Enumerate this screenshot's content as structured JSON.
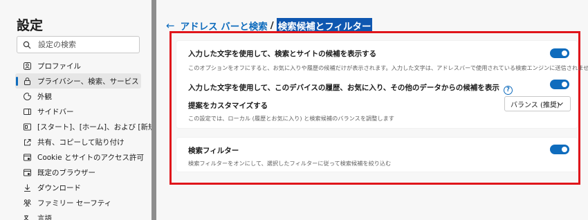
{
  "sidebar": {
    "title": "設定",
    "search_placeholder": "設定の検索",
    "items": [
      {
        "label": "プロファイル",
        "icon": "profile-icon"
      },
      {
        "label": "プライバシー、検索、サービス",
        "icon": "lock-icon",
        "active": true
      },
      {
        "label": "外観",
        "icon": "appearance-icon"
      },
      {
        "label": "サイドバー",
        "icon": "sidebar-icon"
      },
      {
        "label": "[スタート]、[ホーム]、および [新規] タブ",
        "icon": "home-tab-icon"
      },
      {
        "label": "共有、コピーして貼り付け",
        "icon": "share-icon"
      },
      {
        "label": "Cookie とサイトのアクセス許可",
        "icon": "cookie-icon"
      },
      {
        "label": "既定のブラウザー",
        "icon": "browser-icon"
      },
      {
        "label": "ダウンロード",
        "icon": "download-icon"
      },
      {
        "label": "ファミリー セーフティ",
        "icon": "family-icon"
      },
      {
        "label": "言語",
        "icon": "language-icon"
      }
    ]
  },
  "breadcrumb": {
    "back": "←",
    "parent": "アドレス バーと検索",
    "separator": "/",
    "current": "検索候補とフィルター"
  },
  "card1": {
    "row1": {
      "title": "入力した文字を使用して、検索とサイトの候補を表示する",
      "desc": "このオプションをオフにすると、お気に入りや履歴の候補だけが表示されます。入力した文字は、アドレスバーで使用されている検索エンジンに送信されません。",
      "enabled": true
    },
    "row2": {
      "title": "入力した文字を使用して、このデバイスの履歴、お気に入り、その他のデータからの候補を表示",
      "help": "?",
      "enabled": true
    },
    "row3": {
      "title": "提案をカスタマイズする",
      "desc": "この設定では、ローカル (履歴とお気に入り) と検索候補のバランスを調整します",
      "select_value": "バランス (推奨)"
    }
  },
  "card2": {
    "title": "検索フィルター",
    "desc": "検索フィルターをオンにして、選択したフィルターに従って検索候補を絞り込む",
    "enabled": true
  },
  "colors": {
    "accent": "#0f6cbd",
    "highlight_border": "#e0151b",
    "selection": "#0f57b0"
  }
}
